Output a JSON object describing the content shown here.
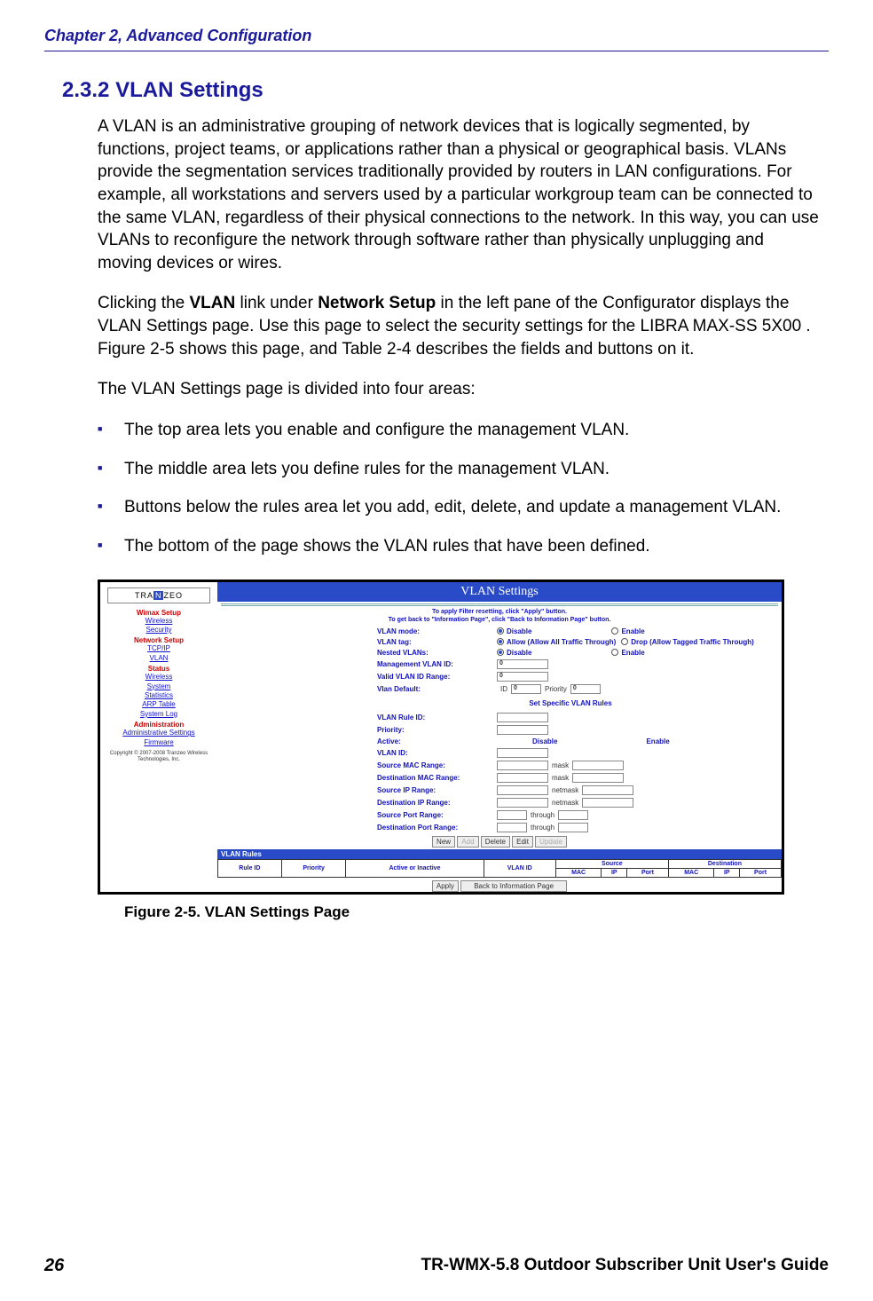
{
  "header": {
    "chapter": "Chapter 2, Advanced Configuration"
  },
  "section": {
    "number": "2.3.2",
    "title": "VLAN Settings"
  },
  "para1": "A VLAN is an administrative grouping of network devices that is logically segmented, by functions, project teams, or applications rather than a physical or geographical basis. VLANs provide the segmentation services traditionally provided by routers in LAN configurations. For example, all workstations and servers used by a particular workgroup team can be connected to the same VLAN, regardless of their physical connections to the network. In this way, you can use VLANs to reconfigure the network through software rather than physically unplugging and moving devices or wires.",
  "para2_a": "Clicking the ",
  "para2_b": " link under ",
  "para2_c": " in the left pane of the Configurator displays the VLAN Settings page. Use this page to select the security settings for the LIBRA MAX-SS 5X00 . Figure 2-5 shows this page, and Table 2-4 describes the fields and buttons on it.",
  "para2_bold1": "VLAN",
  "para2_bold2": "Network Setup",
  "para3": "The VLAN Settings page is divided into four areas:",
  "bullets": {
    "b1": "The top area lets you enable and configure the management VLAN.",
    "b2": "The middle area lets you define rules for the management VLAN.",
    "b3": "Buttons below the rules area let you add, edit, delete, and update a management VLAN.",
    "b4": "The bottom of the page shows the VLAN rules that have been defined."
  },
  "screenshot": {
    "logo_a": "TRA",
    "logo_b": "N",
    "logo_c": "ZEO",
    "side": {
      "g1": "Wimax Setup",
      "g1a": "Wireless",
      "g1b": "Security",
      "g2": "Network Setup",
      "g2a": "TCP/IP",
      "g2b": "VLAN",
      "g3": "Status",
      "g3a": "Wireless",
      "g3b": "System",
      "g3c": "Statistics",
      "g3d": "ARP Table",
      "g3e": "System Log",
      "g4": "Administration",
      "g4a": "Administrative Settings",
      "g4b": "Firmware",
      "copy": "Copyright © 2007-2008 Tranzeo Wireless Technologies, Inc."
    },
    "title": "VLAN Settings",
    "hint1": "To apply Filter resetting, click \"Apply\" button.",
    "hint2": "To get back to \"Information Page\", click \"Back to Information Page\" button.",
    "rows": {
      "mode": "VLAN mode:",
      "mode_a": "Disable",
      "mode_b": "Enable",
      "tag": "VLAN tag:",
      "tag_a": "Allow (Allow All Traffic Through)",
      "tag_b": "Drop (Allow Tagged Traffic Through)",
      "nested": "Nested VLANs:",
      "nested_a": "Disable",
      "nested_b": "Enable",
      "mgmt": "Management VLAN ID:",
      "mgmt_v": "0",
      "range": "Valid VLAN ID Range:",
      "range_v": "0",
      "def": "Vlan Default:",
      "def_id": "ID",
      "def_idv": "0",
      "def_p": "Priority",
      "def_pv": "0",
      "sub": "Set Specific VLAN Rules",
      "ruleid": "VLAN Rule ID:",
      "prio": "Priority:",
      "active": "Active:",
      "active_a": "Disable",
      "active_b": "Enable",
      "vlanid": "VLAN ID:",
      "smac": "Source MAC Range:",
      "mask": "mask",
      "dmac": "Destination MAC Range:",
      "sip": "Source IP Range:",
      "netmask": "netmask",
      "dip": "Destination IP Range:",
      "sport": "Source Port Range:",
      "through": "through",
      "dport": "Destination Port Range:"
    },
    "btns": {
      "new": "New",
      "add": "Add",
      "del": "Delete",
      "edit": "Edit",
      "upd": "Update",
      "apply": "Apply",
      "back": "Back to Information Page"
    },
    "rules_hdr": "VLAN Rules",
    "tbl": {
      "ruleid": "Rule ID",
      "prio": "Priority",
      "act": "Active or Inactive",
      "vlanid": "VLAN ID",
      "src": "Source",
      "dst": "Destination",
      "mac": "MAC",
      "ip": "IP",
      "port": "Port"
    }
  },
  "caption": "Figure 2-5. VLAN Settings Page",
  "footer": {
    "left": "26",
    "right": "TR-WMX-5.8 Outdoor Subscriber Unit User's Guide"
  }
}
